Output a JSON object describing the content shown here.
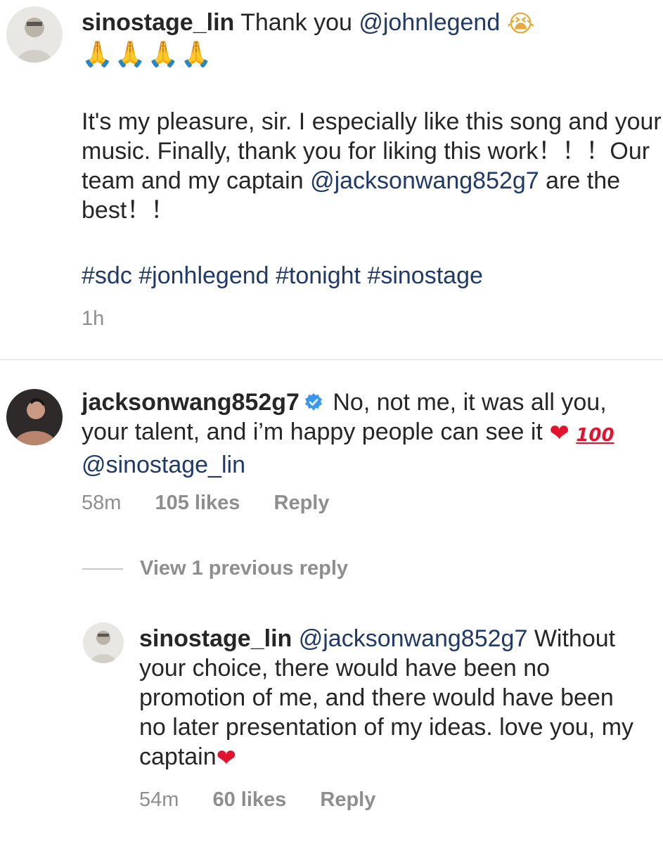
{
  "comments": [
    {
      "username": "sinostage_lin",
      "intro": "Thank you",
      "mention": "@johnlegend",
      "emoji_1": "😭",
      "emoji_2": "🙏🙏🙏🙏",
      "paragraph_1": "It's my pleasure, sir. I especially like this song and your music. Finally, thank you for liking this work！！！Our team and my captain",
      "paragraph_1_mention": "@jacksonwang852g7",
      "paragraph_1_end": "are the best！！",
      "hashtags": "#sdc #jonhlegend #tonight #sinostage",
      "time": "1h",
      "avatar_icon": "user-avatar"
    },
    {
      "username": "jacksonwang852g7",
      "verified_icon": "verified-badge-icon",
      "text": "No, not me, it was all you, your talent, and i’m happy people can see it",
      "emoji_heart": "❤",
      "emoji_100": "100",
      "mention": "@sinostage_lin",
      "time": "58m",
      "likes": "105 likes",
      "reply_label": "Reply",
      "avatar_icon": "user-avatar"
    }
  ],
  "view_replies_label": "View 1 previous reply",
  "reply": {
    "username": "sinostage_lin",
    "mention": "@jacksonwang852g7",
    "text": "Without your choice, there would have been no promotion of me, and there would have been no later presentation of my ideas. love you, my captain",
    "emoji_heart": "❤",
    "time": "54m",
    "likes": "60 likes",
    "reply_label": "Reply",
    "avatar_icon": "user-avatar"
  },
  "colors": {
    "link": "#1f3a68",
    "muted": "#8e8e8e",
    "text": "#262626",
    "verified": "#3897f0",
    "heart": "#e0142e"
  }
}
